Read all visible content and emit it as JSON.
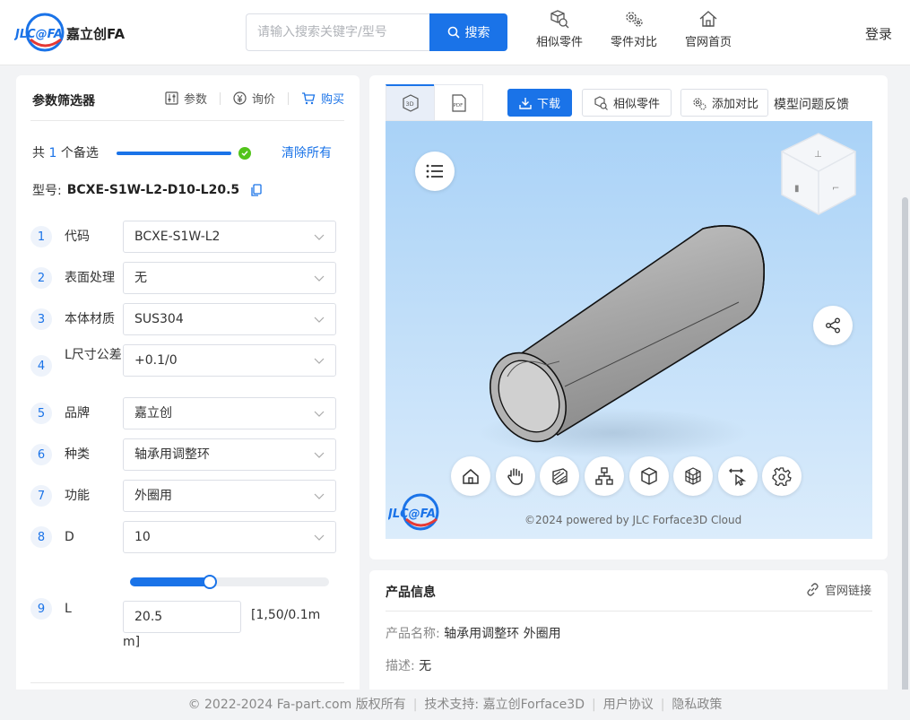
{
  "header": {
    "brand": "嘉立创FA",
    "logo_text": "JLC@FA",
    "search_placeholder": "请输入搜索关键字/型号",
    "search_button": "搜索",
    "nav": [
      "相似零件",
      "零件对比",
      "官网首页"
    ],
    "login": "登录"
  },
  "filter": {
    "title": "参数筛选器",
    "tabs": [
      "参数",
      "询价",
      "购买"
    ],
    "count_prefix": "共",
    "count": "1",
    "count_suffix": "个备选",
    "progress": 1.0,
    "clear_all": "清除所有",
    "model_label": "型号:",
    "model_value": "BCXE-S1W-L2-D10-L20.5",
    "fields": [
      {
        "num": "1",
        "label": "代码",
        "value": "BCXE-S1W-L2"
      },
      {
        "num": "2",
        "label": "表面处理",
        "value": "无"
      },
      {
        "num": "3",
        "label": "本体材质",
        "value": "SUS304"
      },
      {
        "num": "4",
        "label": "L尺寸公差",
        "value": "+0.1/0"
      },
      {
        "num": "5",
        "label": "品牌",
        "value": "嘉立创"
      },
      {
        "num": "6",
        "label": "种类",
        "value": "轴承用调整环"
      },
      {
        "num": "7",
        "label": "功能",
        "value": "外圈用"
      },
      {
        "num": "8",
        "label": "D",
        "value": "10"
      }
    ],
    "l_field": {
      "num": "9",
      "label": "L",
      "value": "20.5",
      "range_a": "[1,50/0.1m",
      "range_b": "m]",
      "slider_fraction": 0.4
    }
  },
  "viewer": {
    "tabs": [
      "3D",
      "PDF"
    ],
    "download": "下载",
    "similar": "相似零件",
    "add_compare": "添加对比",
    "feedback": "模型问题反馈",
    "copyright": "©2024 powered by JLC Forface3D Cloud",
    "logo_text": "JLC@FA",
    "tools": [
      "home-icon",
      "hand-icon",
      "section-icon",
      "tree-icon",
      "box-icon",
      "explode-icon",
      "measure-icon",
      "settings-icon"
    ]
  },
  "product": {
    "title": "产品信息",
    "link": "官网链接",
    "name_label": "产品名称:",
    "name_value": "轴承用调整环 外圈用",
    "desc_label": "描述:",
    "desc_value": "无"
  },
  "footer": {
    "copyright": "© 2022-2024 Fa-part.com 版权所有",
    "support": "技术支持: 嘉立创Forface3D",
    "agreement": "用户协议",
    "privacy": "隐私政策"
  },
  "colors": {
    "accent": "#1a73e8",
    "success": "#52c41a"
  }
}
